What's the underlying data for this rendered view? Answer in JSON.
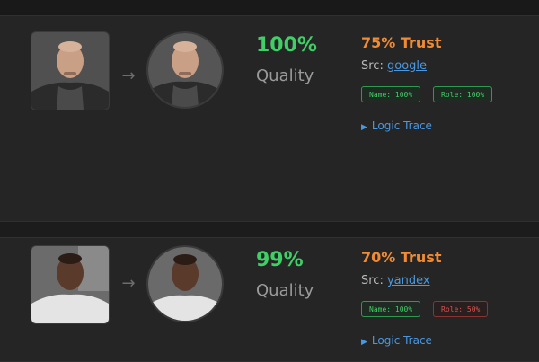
{
  "results": [
    {
      "quality_value": "100%",
      "quality_label": "Quality",
      "trust": "75% Trust",
      "src_prefix": "Src:",
      "src_link": "google",
      "badges": [
        {
          "label": "Name: 100%",
          "status": "ok"
        },
        {
          "label": "Role: 100%",
          "status": "ok"
        }
      ],
      "trace_label": "Logic Trace",
      "thumb_icon": "person-photo-icon",
      "circle_icon": "person-photo-icon"
    },
    {
      "quality_value": "99%",
      "quality_label": "Quality",
      "trust": "70% Trust",
      "src_prefix": "Src:",
      "src_link": "yandex",
      "badges": [
        {
          "label": "Name: 100%",
          "status": "ok"
        },
        {
          "label": "Role: 50%",
          "status": "bad"
        }
      ],
      "trace_label": "Logic Trace",
      "thumb_icon": "person-photo-icon",
      "circle_icon": "person-photo-icon"
    }
  ],
  "colors": {
    "quality": "#3fcf66",
    "trust": "#f08a33",
    "link": "#4a98e0",
    "ok": "#3fcf66",
    "bad": "#d9534f"
  }
}
